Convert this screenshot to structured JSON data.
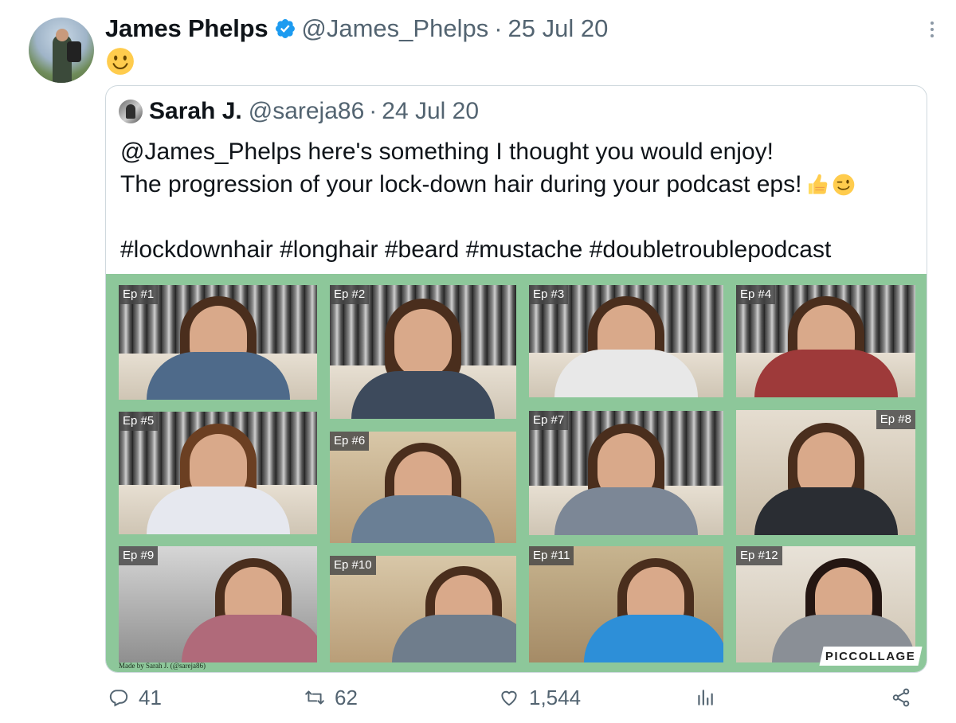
{
  "tweet": {
    "author_name": "James Phelps",
    "author_handle": "@James_Phelps",
    "separator": "·",
    "date": "25 Jul 20",
    "verified_icon": "verified-badge-icon",
    "body_emoji": "slightly-smiling-face-emoji",
    "accent_color": "#1d9bf0"
  },
  "quote": {
    "author_name": "Sarah J.",
    "author_handle": "@sareja86",
    "separator": "·",
    "date": "24 Jul 20",
    "text_line_1": "@James_Phelps here's something I thought you would enjoy!",
    "text_line_2": "The progression of your lock-down hair during your podcast eps!",
    "text_line_2_emojis": [
      "thumbs-up-emoji",
      "winking-face-emoji"
    ],
    "hashtags": "#lockdownhair #longhair #beard #mustache #doubletroublepodcast",
    "collage": {
      "episodes": [
        "Ep #1",
        "Ep #2",
        "Ep #3",
        "Ep #4",
        "Ep #5",
        "Ep #6",
        "Ep #7",
        "Ep #8",
        "Ep #9",
        "Ep #10",
        "Ep #11",
        "Ep #12"
      ],
      "credit": "Made by Sarah J. (@sareja86)",
      "logo": "PICCOLLAGE",
      "background_color": "#8dc79a"
    }
  },
  "actions": {
    "replies": "41",
    "retweets": "62",
    "likes": "1,544",
    "icons": [
      "reply-icon",
      "retweet-icon",
      "like-icon",
      "views-icon",
      "share-icon"
    ]
  }
}
